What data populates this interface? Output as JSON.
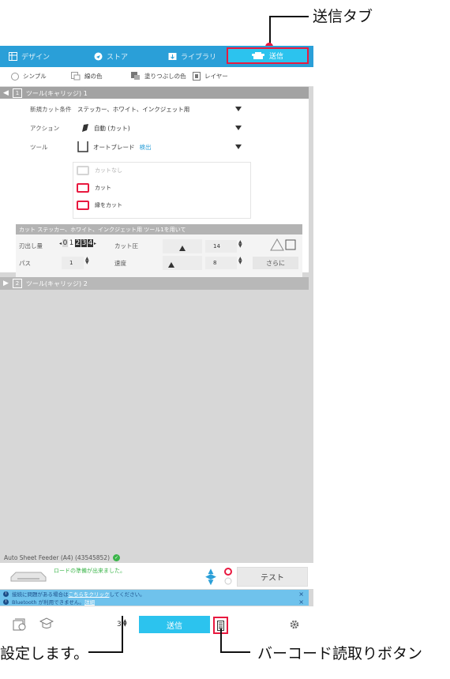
{
  "callouts": {
    "send_tab": "送信タブ",
    "left_partial": "設定します。",
    "barcode_button": "バーコード読取りボタン"
  },
  "tabs": [
    {
      "label": "デザイン",
      "icon": "grid-icon"
    },
    {
      "label": "ストア",
      "icon": "store-icon"
    },
    {
      "label": "ライブラリ",
      "icon": "library-icon"
    },
    {
      "label": "送信",
      "icon": "send-icon",
      "active": true
    }
  ],
  "modes": [
    {
      "label": "シンプル",
      "icon": "radio-icon"
    },
    {
      "label": "線の色",
      "icon": "line-color-icon"
    },
    {
      "label": "塗りつぶしの色",
      "icon": "fill-color-icon"
    },
    {
      "label": "レイヤー",
      "icon": "layer-icon"
    }
  ],
  "tool1": {
    "num": "1",
    "label": "ツール(キャリッジ) 1"
  },
  "tool2": {
    "num": "2",
    "label": "ツール(キャリッジ) 2"
  },
  "settings": {
    "media_label": "新規カット条件",
    "media_value": "ステッカー、ホワイト、インクジェット用",
    "action_label": "アクション",
    "action_value": "自動 (カット)",
    "tool_label": "ツール",
    "tool_value": "オートブレード",
    "tool_detect": "検出"
  },
  "cut_options": [
    {
      "label": "カットなし",
      "enabled": false
    },
    {
      "label": "カット",
      "enabled": true
    },
    {
      "label": "縁をカット",
      "enabled": true
    }
  ],
  "cut_settings": {
    "header": "カット ステッカー、ホワイト、インクジェット用 ツール1を用いて",
    "blade_label": "刃出し量",
    "blade_digits": [
      "0",
      "1",
      "2",
      "3",
      "4"
    ],
    "force_label": "カット圧",
    "force_value": "14",
    "passes_label": "パス",
    "passes_value": "1",
    "speed_label": "速度",
    "speed_value": "8",
    "more_button": "さらに"
  },
  "device": {
    "name": "Auto Sheet Feeder (A4) (43545852)",
    "status": "ロードの準備が出来ました。",
    "test_button": "テスト"
  },
  "notices": [
    {
      "text_before": "接続に問題がある場合は",
      "link": "こちらをクリック",
      "text_after": "してください。"
    },
    {
      "text_before": "Bluetooth が利用できません。",
      "link": "詳細",
      "text_after": ""
    }
  ],
  "bottom": {
    "copies_value": "3",
    "send_button": "送信"
  },
  "colors": {
    "accent_blue": "#2a9fd8",
    "send_cyan": "#2cc3ee",
    "highlight_red": "#e8193f",
    "status_green": "#3bb54a"
  }
}
